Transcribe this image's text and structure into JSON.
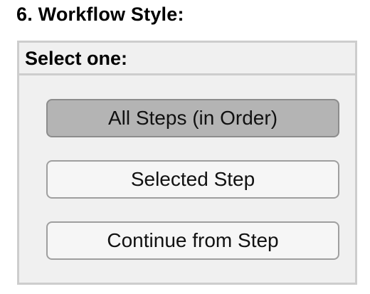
{
  "section": {
    "title": "6. Workflow Style:"
  },
  "panel": {
    "header": "Select one:"
  },
  "options": [
    {
      "label": "All Steps (in Order)",
      "selected": true
    },
    {
      "label": "Selected Step",
      "selected": false
    },
    {
      "label": "Continue from Step",
      "selected": false
    }
  ]
}
